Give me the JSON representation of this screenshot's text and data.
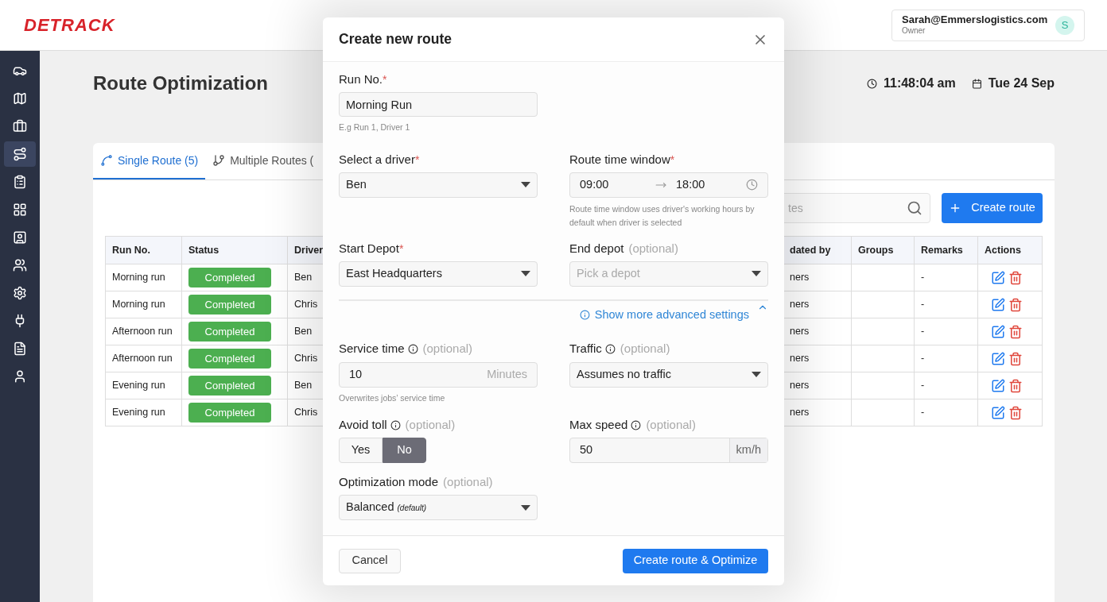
{
  "header": {
    "logo": "DETRACK",
    "user": {
      "email": "Sarah@Emmerslogistics.com",
      "role": "Owner",
      "initial": "S"
    }
  },
  "sidebar": {
    "items": [
      {
        "kind": "car",
        "selected": false
      },
      {
        "kind": "map",
        "selected": false
      },
      {
        "kind": "briefcase",
        "selected": false
      },
      {
        "kind": "route",
        "selected": true
      },
      {
        "kind": "clipboard",
        "selected": false
      },
      {
        "kind": "grid",
        "selected": false
      },
      {
        "kind": "contact",
        "selected": false
      },
      {
        "kind": "users",
        "selected": false
      },
      {
        "kind": "settings",
        "selected": false
      },
      {
        "kind": "plug",
        "selected": false
      },
      {
        "kind": "document",
        "selected": false
      },
      {
        "kind": "user",
        "selected": false
      }
    ]
  },
  "page": {
    "title": "Route Optimization",
    "time": "11:48:04 am",
    "date": "Tue 24 Sep"
  },
  "tabs": [
    {
      "kind": "single",
      "label": "Single Route (5)",
      "selected": true
    },
    {
      "kind": "multiple",
      "label": "Multiple Routes (",
      "selected": false
    }
  ],
  "search": {
    "placeholder": "tes"
  },
  "create_button": "Create route",
  "table": {
    "columns_left": [
      "Run No.",
      "Status",
      "Driver"
    ],
    "columns_right": [
      "dated by",
      "Groups",
      "Remarks",
      "Actions"
    ],
    "rows": [
      {
        "run": "Morning run",
        "status": "Completed",
        "driver": "Ben",
        "updated_by": "ners",
        "remarks": "-"
      },
      {
        "run": "Morning run",
        "status": "Completed",
        "driver": "Chris",
        "updated_by": "ners",
        "remarks": "-"
      },
      {
        "run": "Afternoon run",
        "status": "Completed",
        "driver": "Ben",
        "updated_by": "ners",
        "remarks": "-"
      },
      {
        "run": "Afternoon run",
        "status": "Completed",
        "driver": "Chris",
        "updated_by": "ners",
        "remarks": "-"
      },
      {
        "run": "Evening run",
        "status": "Completed",
        "driver": "Ben",
        "updated_by": "ners",
        "remarks": "-"
      },
      {
        "run": "Evening run",
        "status": "Completed",
        "driver": "Chris",
        "updated_by": "ners",
        "remarks": "-"
      }
    ]
  },
  "modal": {
    "title": "Create new route",
    "run_no": {
      "label": "Run No.",
      "suffix": "*",
      "required": true,
      "value": "Morning Run",
      "help": "E.g Run 1, Driver 1"
    },
    "driver": {
      "label": "Select a driver",
      "suffix": "*",
      "required": true,
      "value": "Ben"
    },
    "time_window": {
      "label": "Route time window",
      "suffix": "*",
      "required": true,
      "start": "09:00",
      "end": "18:00",
      "help": "Route time window uses driver's working hours by default when driver is selected"
    },
    "start_depot": {
      "label": "Start Depot",
      "suffix": "*",
      "required": true,
      "value": "East Headquarters"
    },
    "end_depot": {
      "label": "End depot",
      "suffix": "(optional)",
      "required": false,
      "placeholder": "Pick a depot"
    },
    "advanced": {
      "label": "Show more advanced settings",
      "expanded": true
    },
    "service_time": {
      "label": "Service time",
      "info": true,
      "suffix": "(optional)",
      "required": false,
      "value": "10",
      "unit": "Minutes",
      "help": "Overwrites jobs’ service time"
    },
    "traffic": {
      "label": "Traffic",
      "info": true,
      "suffix": "(optional)",
      "required": false,
      "value": "Assumes no traffic"
    },
    "avoid_toll": {
      "label": "Avoid toll",
      "info": true,
      "suffix": "(optional)",
      "required": false,
      "options": [
        {
          "label": "Yes",
          "selected": false
        },
        {
          "label": "No",
          "selected": true
        }
      ]
    },
    "max_speed": {
      "label": "Max speed",
      "info": true,
      "suffix": "(optional)",
      "required": false,
      "value": "50",
      "unit": "km/h"
    },
    "optimization_mode": {
      "label": "Optimization mode",
      "suffix": "(optional)",
      "required": false,
      "value": "Balanced",
      "note": "(default)"
    },
    "cancel": "Cancel",
    "submit": "Create route & Optimize"
  }
}
